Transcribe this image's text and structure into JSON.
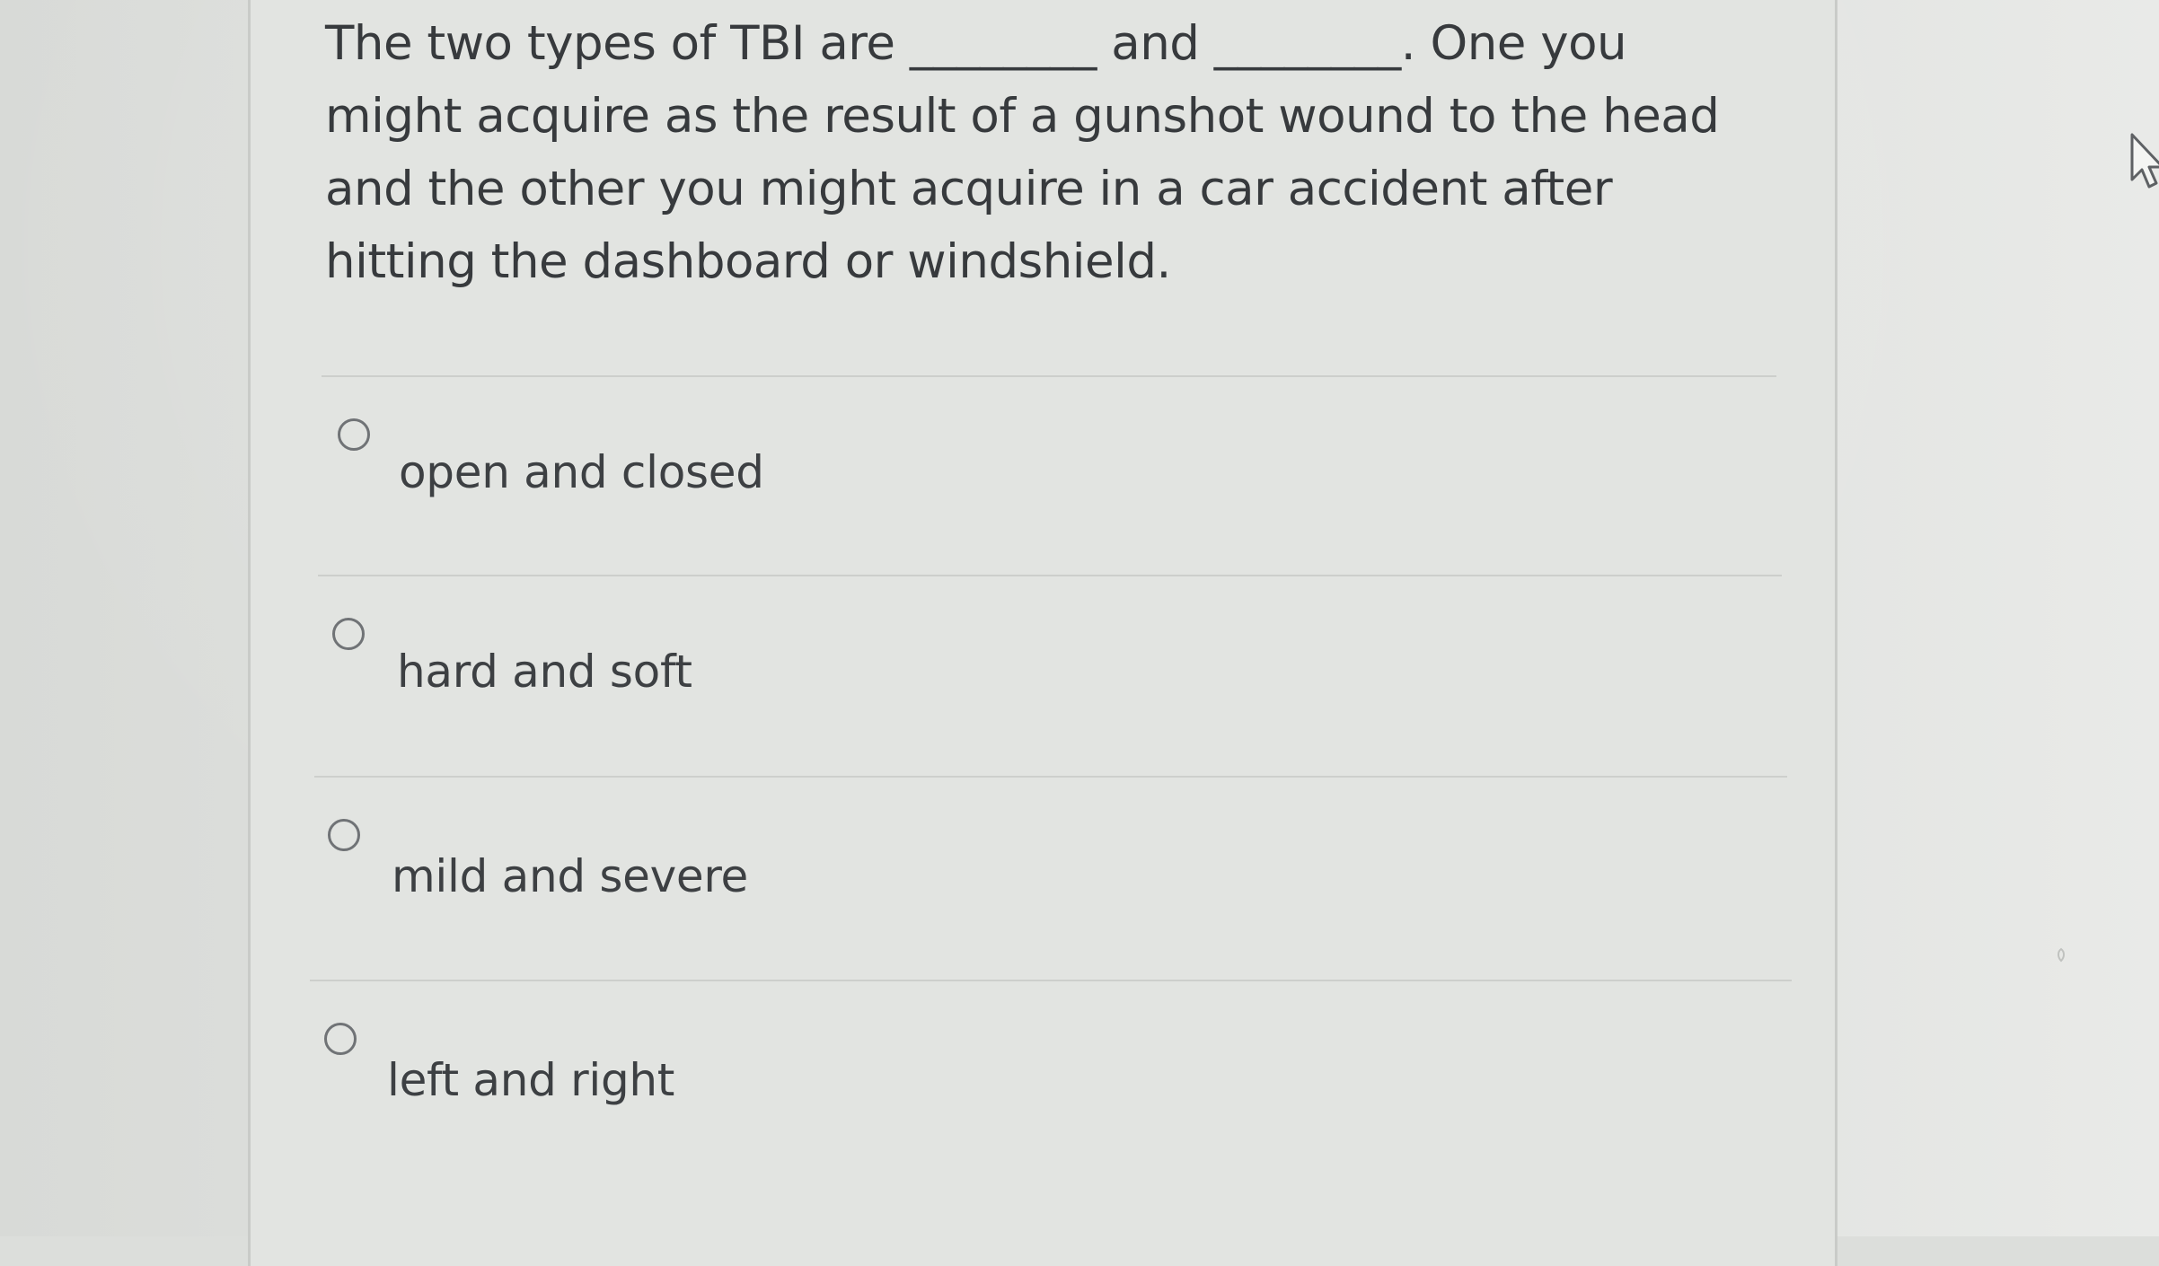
{
  "question": {
    "text": "The two types of TBI are ________ and ________. One you might acquire as the result of a gunshot wound to the head and the other you might acquire in a car accident after hitting the dashboard or windshield."
  },
  "options": [
    {
      "label": "open and closed",
      "selected": false
    },
    {
      "label": "hard and soft",
      "selected": false
    },
    {
      "label": "mild and severe",
      "selected": false
    },
    {
      "label": "left and right",
      "selected": false
    }
  ],
  "icons": {
    "cursor": "mouse-pointer-icon",
    "radio": "radio-circle-icon"
  },
  "colors": {
    "text": "#373a3d",
    "radio_border": "#707376",
    "divider": "#cdcfcc",
    "card_background": "#e2e4e1"
  }
}
